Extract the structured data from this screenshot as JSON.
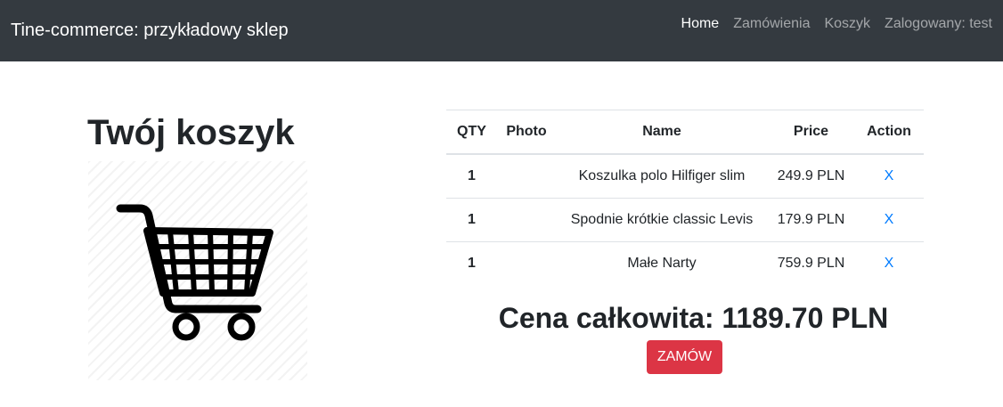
{
  "navbar": {
    "brand": "Tine-commerce: przykładowy sklep",
    "links": [
      "Home",
      "Zamówienia",
      "Koszyk",
      "Zalogowany: test"
    ]
  },
  "cart": {
    "title": "Twój koszyk",
    "image_icon": "shopping-cart-icon"
  },
  "table": {
    "headers": [
      "QTY",
      "Photo",
      "Name",
      "Price",
      "Action"
    ],
    "rows": [
      {
        "qty": "1",
        "photo": "",
        "name": "Koszulka polo Hilfiger slim",
        "price": "249.9 PLN",
        "action": "X"
      },
      {
        "qty": "1",
        "photo": "",
        "name": "Spodnie krótkie classic Levis",
        "price": "179.9 PLN",
        "action": "X"
      },
      {
        "qty": "1",
        "photo": "",
        "name": "Małe Narty",
        "price": "759.9 PLN",
        "action": "X"
      }
    ]
  },
  "total": "Cena całkowita: 1189.70 PLN",
  "order_button": "ZAMÓW",
  "colors": {
    "navbar": "#343a40",
    "link": "#007bff",
    "danger": "#dc3545"
  }
}
